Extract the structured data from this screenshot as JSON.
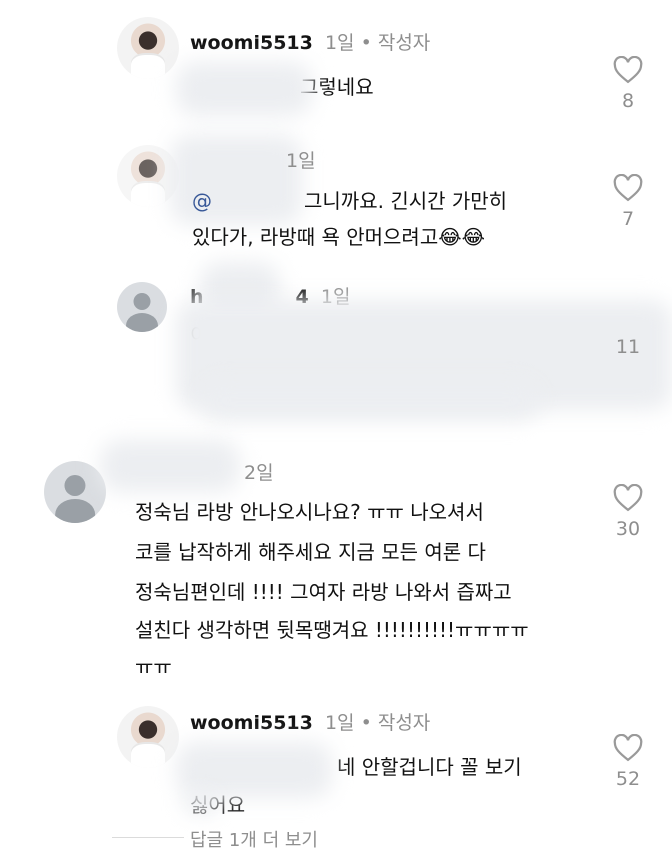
{
  "comments": [
    {
      "user": "woomi5513",
      "time": "1일",
      "dot": "•",
      "author_badge": "작성자",
      "text_lines": [
        "그렇네요"
      ],
      "likes": "8"
    },
    {
      "user": "",
      "time": "1일",
      "mention": "@",
      "text_lines": [
        "그니까요. 긴시간 가만히",
        "있다가, 라방때 욕 안머으려고"
      ],
      "emoji": "😂😂",
      "likes": "7"
    },
    {
      "user": "h",
      "user_suffix": "4",
      "time": "1일",
      "text_lines": [
        "이"
      ],
      "likes": "11"
    },
    {
      "user": "",
      "time": "2일",
      "text_lines": [
        "정숙님 라방 안나오시나요? ㅠㅠ 나오셔서",
        "코를 납작하게 해주세요 지금 모든 여론 다",
        "정숙님편인데 !!!! 그여자 라방 나와서 즙짜고",
        "설친다 생각하면 뒷목땡겨요 !!!!!!!!!!ㅠㅠㅠㅠ",
        "ㅠㅠ"
      ],
      "likes": "30"
    },
    {
      "user": "woomi5513",
      "time": "1일",
      "dot": "•",
      "author_badge": "작성자",
      "text_lines": [
        "네 안할겁니다 꼴 보기",
        "싫어요"
      ],
      "likes": "52"
    }
  ],
  "more_replies_label": "답글 1개 더 보기",
  "icons": {
    "like": "heart-outline-icon",
    "avatar_default": "user-silhouette-icon"
  }
}
